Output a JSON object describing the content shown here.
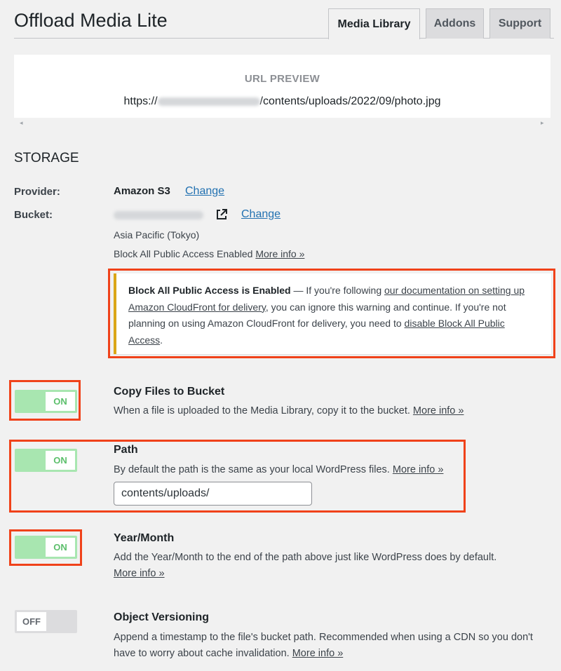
{
  "header": {
    "title": "Offload Media Lite",
    "tabs": [
      {
        "label": "Media Library",
        "active": true
      },
      {
        "label": "Addons",
        "active": false
      },
      {
        "label": "Support",
        "active": false
      }
    ]
  },
  "url_preview": {
    "label": "URL PREVIEW",
    "url_prefix": "https://",
    "url_suffix": "/contents/uploads/2022/09/photo.jpg",
    "left_arrow": "◂",
    "right_arrow": "▸"
  },
  "storage": {
    "title": "STORAGE",
    "provider_label": "Provider:",
    "provider_value": "Amazon S3",
    "provider_change": "Change",
    "bucket_label": "Bucket:",
    "bucket_change": "Change",
    "region": "Asia Pacific (Tokyo)",
    "public_access_text": "Block All Public Access Enabled",
    "public_access_more": "More info »"
  },
  "warning": {
    "bold": "Block All Public Access is Enabled",
    "text1": " — If you're following ",
    "link1": "our documentation on setting up Amazon CloudFront for delivery",
    "text2": ", you can ignore this warning and continue. If you're not planning on using Amazon CloudFront for delivery, you need to ",
    "link2": "disable Block All Public Access",
    "text3": "."
  },
  "settings": {
    "copy_files": {
      "toggle": "ON",
      "title": "Copy Files to Bucket",
      "desc": "When a file is uploaded to the Media Library, copy it to the bucket. ",
      "more": "More info »"
    },
    "path": {
      "toggle": "ON",
      "title": "Path",
      "desc": "By default the path is the same as your local WordPress files. ",
      "more": "More info »",
      "value": "contents/uploads/"
    },
    "year_month": {
      "toggle": "ON",
      "title": "Year/Month",
      "desc": "Add the Year/Month to the end of the path above just like WordPress does by default.",
      "more": "More info »"
    },
    "object_versioning": {
      "toggle": "OFF",
      "title": "Object Versioning",
      "desc": "Append a timestamp to the file's bucket path. Recommended when using a CDN so you don't have to worry about cache invalidation. ",
      "more": "More info »"
    }
  },
  "colors": {
    "highlight": "#f0421a",
    "toggle_on": "#a8e6b0",
    "toggle_off": "#dcdcde",
    "link": "#2271b1",
    "warning_accent": "#dba617"
  }
}
